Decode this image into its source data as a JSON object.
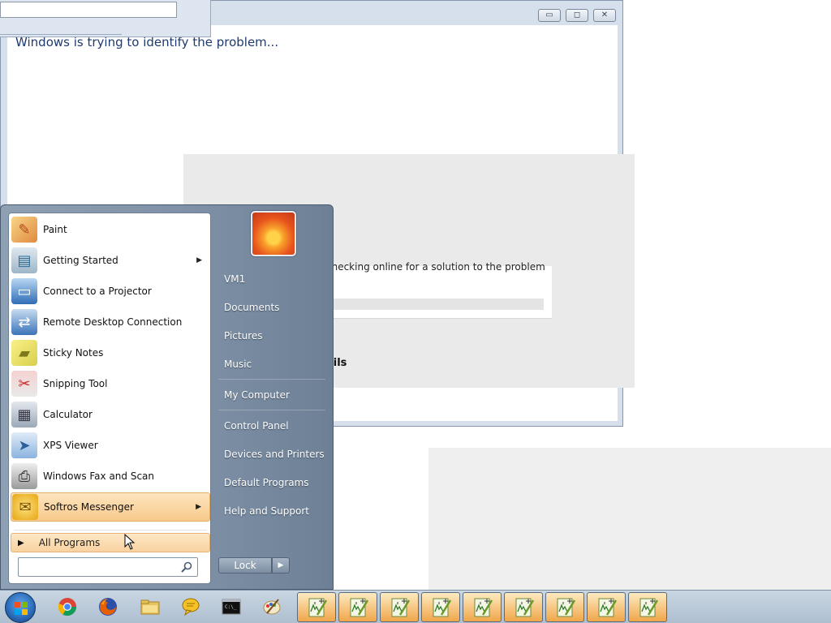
{
  "window": {
    "message": "Windows is trying to identify the problem...",
    "checking_text": "checking online for a solution to the problem",
    "details_text": "ails",
    "minimize_glyph": "▭",
    "maximize_glyph": "◻",
    "close_glyph": "✕"
  },
  "start_menu": {
    "programs": [
      {
        "label": "Paint",
        "icon": "paint-icon",
        "arrow": ""
      },
      {
        "label": "Getting Started",
        "icon": "getting-started-icon",
        "arrow": "▶"
      },
      {
        "label": "Connect to a Projector",
        "icon": "projector-icon",
        "arrow": ""
      },
      {
        "label": "Remote Desktop Connection",
        "icon": "remote-desktop-icon",
        "arrow": ""
      },
      {
        "label": "Sticky Notes",
        "icon": "sticky-notes-icon",
        "arrow": ""
      },
      {
        "label": "Snipping Tool",
        "icon": "snipping-tool-icon",
        "arrow": ""
      },
      {
        "label": "Calculator",
        "icon": "calculator-icon",
        "arrow": ""
      },
      {
        "label": "XPS Viewer",
        "icon": "xps-viewer-icon",
        "arrow": ""
      },
      {
        "label": "Windows Fax and Scan",
        "icon": "fax-scan-icon",
        "arrow": ""
      },
      {
        "label": "Softros Messenger",
        "icon": "messenger-icon",
        "arrow": "▶"
      }
    ],
    "all_programs": "All Programs",
    "all_programs_arrow": "▶",
    "search_value": "",
    "right_items": [
      {
        "label": "VM1"
      },
      {
        "label": "Documents"
      },
      {
        "label": "Pictures"
      },
      {
        "label": "Music"
      },
      {
        "label": "My Computer"
      },
      {
        "label": "Control Panel"
      },
      {
        "label": "Devices and Printers"
      },
      {
        "label": "Default Programs"
      },
      {
        "label": "Help and Support"
      }
    ],
    "lock_label": "Lock",
    "lock_arrow": "▶"
  },
  "taskbar": {
    "buttons": [
      {
        "name": "chrome-icon",
        "active": false
      },
      {
        "name": "firefox-icon",
        "active": false
      },
      {
        "name": "file-explorer-icon",
        "active": false
      },
      {
        "name": "messenger-icon",
        "active": false
      },
      {
        "name": "command-prompt-icon",
        "active": false
      },
      {
        "name": "paint-icon",
        "active": false
      },
      {
        "name": "notepad-plus-icon",
        "active": true
      },
      {
        "name": "notepad-plus-icon",
        "active": true
      },
      {
        "name": "notepad-plus-icon",
        "active": true
      },
      {
        "name": "notepad-plus-icon",
        "active": true
      },
      {
        "name": "notepad-plus-icon",
        "active": true
      },
      {
        "name": "notepad-plus-icon",
        "active": true
      },
      {
        "name": "notepad-plus-icon",
        "active": true
      },
      {
        "name": "notepad-plus-icon",
        "active": true
      },
      {
        "name": "notepad-plus-icon",
        "active": true
      }
    ]
  },
  "colors": {
    "highlight": "#f8c98b",
    "menu_right_pane": "#7e90a5",
    "taskbar": "#c9d6e3"
  }
}
